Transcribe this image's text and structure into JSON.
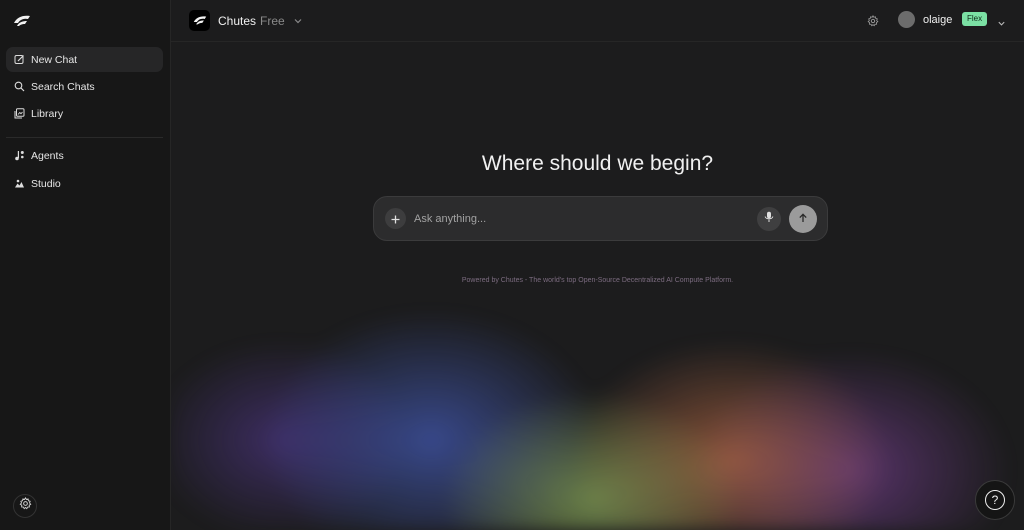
{
  "sidebar": {
    "items": [
      {
        "label": "New Chat",
        "icon": "edit-icon"
      },
      {
        "label": "Search Chats",
        "icon": "search-icon"
      },
      {
        "label": "Library",
        "icon": "library-icon"
      },
      {
        "label": "Agents",
        "icon": "agents-icon"
      },
      {
        "label": "Studio",
        "icon": "studio-icon"
      }
    ]
  },
  "header": {
    "brand_name": "Chutes",
    "plan": "Free",
    "username": "olaige",
    "badge": "Flex"
  },
  "main": {
    "heading": "Where should we begin?",
    "input_placeholder": "Ask anything...",
    "powered_by": "Powered by Chutes - The world's top Open-Source Decentralized AI Compute Platform."
  },
  "help": {
    "label": "?"
  },
  "colors": {
    "background": "#1c1c1d",
    "sidebar": "#171717",
    "badge": "#7be0a4",
    "send_button": "#9b9b9b"
  }
}
